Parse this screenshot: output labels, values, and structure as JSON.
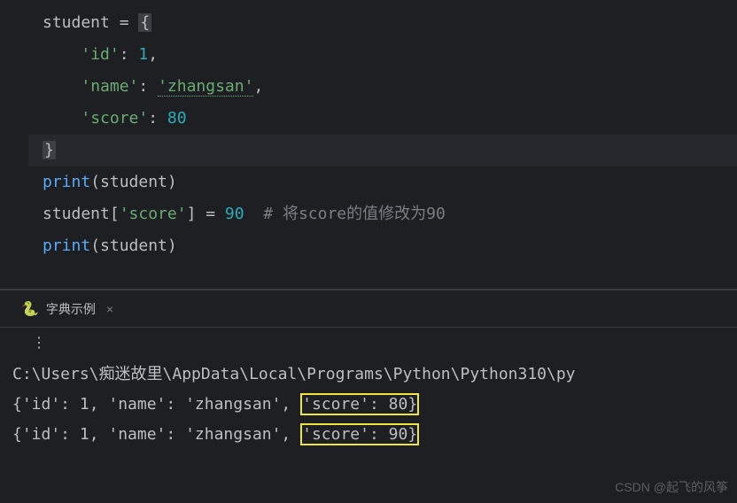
{
  "editor": {
    "line_numbers": [
      "",
      "",
      "",
      "",
      "",
      "",
      "",
      ""
    ],
    "lines": {
      "l0": {
        "indent": "",
        "var": "student",
        "eq": " = ",
        "brace": "{"
      },
      "l1": {
        "indent": "    ",
        "key": "'id'",
        "colon": ": ",
        "val": "1",
        "comma": ","
      },
      "l2": {
        "indent": "    ",
        "key": "'name'",
        "colon": ": ",
        "val": "'zhangsan'",
        "comma": ","
      },
      "l3": {
        "indent": "    ",
        "key": "'score'",
        "colon": ": ",
        "val": "80"
      },
      "l4": {
        "brace": "}"
      },
      "l5": {
        "func": "print",
        "open": "(",
        "arg": "student",
        "close": ")"
      },
      "l6": {
        "var": "student",
        "open": "[",
        "key": "'score'",
        "close": "]",
        "eq": " = ",
        "val": "90",
        "comment": "  # 将score的值修改为90"
      },
      "l7": {
        "func": "print",
        "open": "(",
        "arg": "student",
        "close": ")"
      }
    }
  },
  "tab": {
    "label": "字典示例",
    "close": "×"
  },
  "output": {
    "path": "C:\\Users\\痴迷故里\\AppData\\Local\\Programs\\Python\\Python310\\py",
    "line1_pre": "{'id': 1, 'name': 'zhangsan', ",
    "line1_box": "'score': 80}",
    "line2_pre": "{'id': 1, 'name': 'zhangsan', ",
    "line2_box": "'score': 90}"
  },
  "watermark": "CSDN @起飞的风筝"
}
